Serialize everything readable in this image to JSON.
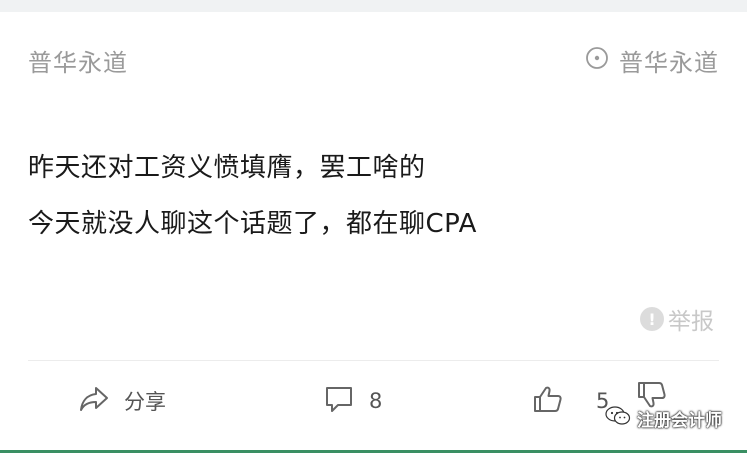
{
  "post": {
    "author": "普华永道",
    "follow_label": "普华永道",
    "lines": [
      "昨天还对工资义愤填膺，罢工啥的",
      "今天就没人聊这个话题了，都在聊CPA"
    ],
    "report_label": "举报"
  },
  "actions": {
    "share_label": "分享",
    "comment_count": "8",
    "like_count": "5"
  },
  "watermark": {
    "text": "注册会计师"
  },
  "icons": {
    "follow": "target-circle-icon",
    "report": "exclamation-icon",
    "share": "share-arrow-icon",
    "comment": "comment-bubble-icon",
    "like": "thumbs-up-icon",
    "dislike": "thumbs-down-icon",
    "watermark": "wechat-icon"
  },
  "colors": {
    "background": "#f0f2f3",
    "card": "#ffffff",
    "muted_text": "#9a9a9a",
    "body_text": "#1a1a1a",
    "accent_bar": "#3a8f63"
  }
}
